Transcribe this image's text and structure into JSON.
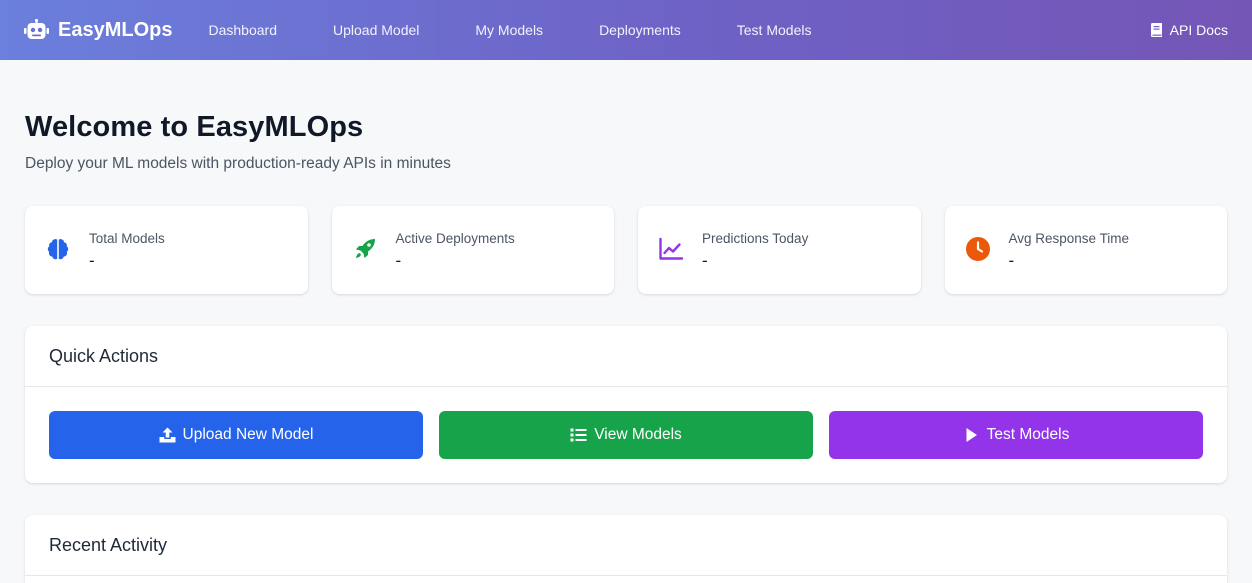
{
  "navbar": {
    "brand": "EasyMLOps",
    "links": [
      "Dashboard",
      "Upload Model",
      "My Models",
      "Deployments",
      "Test Models"
    ],
    "api_docs": "API Docs"
  },
  "page": {
    "title": "Welcome to EasyMLOps",
    "subtitle": "Deploy your ML models with production-ready APIs in minutes"
  },
  "stats": [
    {
      "label": "Total Models",
      "value": "-",
      "icon": "brain-icon",
      "color": "#2563eb"
    },
    {
      "label": "Active Deployments",
      "value": "-",
      "icon": "rocket-icon",
      "color": "#16a34a"
    },
    {
      "label": "Predictions Today",
      "value": "-",
      "icon": "chart-line-icon",
      "color": "#9333ea"
    },
    {
      "label": "Avg Response Time",
      "value": "-",
      "icon": "clock-icon",
      "color": "#ea580c"
    }
  ],
  "quick_actions": {
    "title": "Quick Actions",
    "buttons": [
      {
        "label": "Upload New Model",
        "icon": "upload-icon",
        "color": "#2563eb"
      },
      {
        "label": "View Models",
        "icon": "list-icon",
        "color": "#16a34a"
      },
      {
        "label": "Test Models",
        "icon": "play-icon",
        "color": "#9333ea"
      }
    ]
  },
  "recent_activity": {
    "title": "Recent Activity"
  }
}
